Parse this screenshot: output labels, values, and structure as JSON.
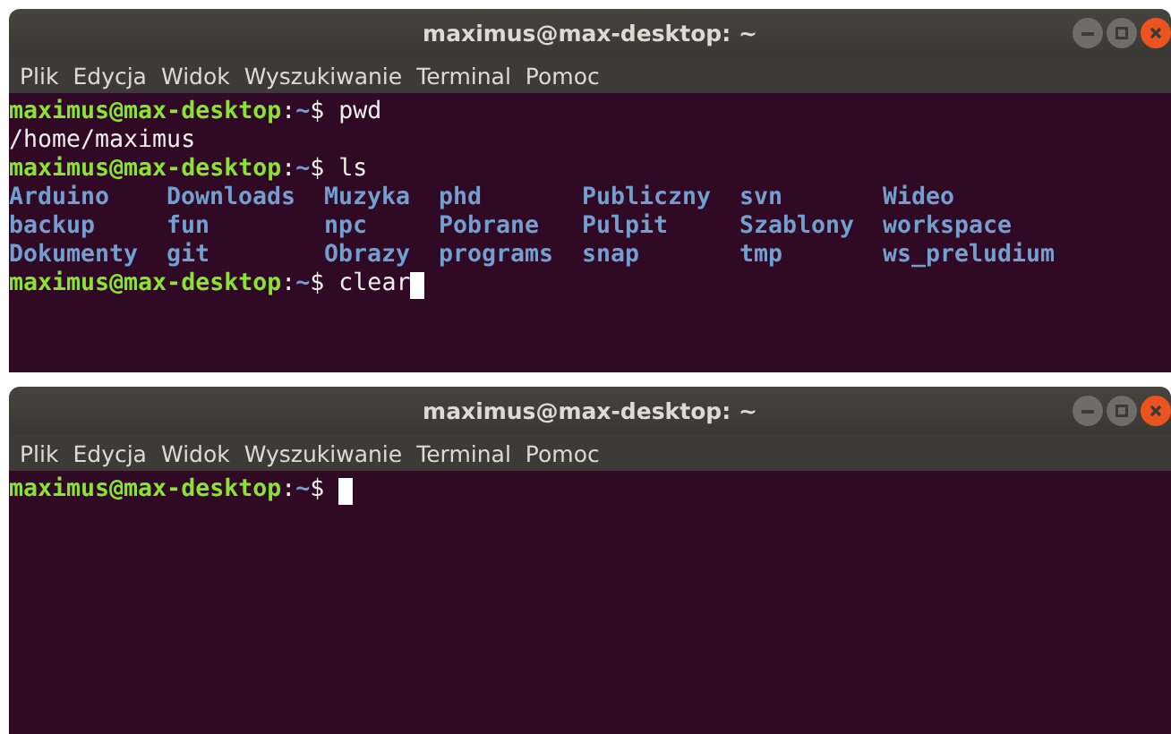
{
  "windows": [
    {
      "title": "maximus@max-desktop: ~",
      "menu": [
        "Plik",
        "Edycja",
        "Widok",
        "Wyszukiwanie",
        "Terminal",
        "Pomoc"
      ],
      "lines": [
        {
          "kind": "prompt",
          "user_host": "maximus@max-desktop",
          "separator": ":",
          "path": "~",
          "symbol": "$",
          "command": "pwd",
          "cursor": false
        },
        {
          "kind": "output",
          "text": "/home/maximus"
        },
        {
          "kind": "prompt",
          "user_host": "maximus@max-desktop",
          "separator": ":",
          "path": "~",
          "symbol": "$",
          "command": "ls",
          "cursor": false
        },
        {
          "kind": "listing",
          "rows": [
            [
              "Arduino",
              "Downloads",
              "Muzyka",
              "phd",
              "Publiczny",
              "svn",
              "Wideo"
            ],
            [
              "backup",
              "fun",
              "npc",
              "Pobrane",
              "Pulpit",
              "Szablony",
              "workspace"
            ],
            [
              "Dokumenty",
              "git",
              "Obrazy",
              "programs",
              "snap",
              "tmp",
              "ws_preludium"
            ]
          ]
        },
        {
          "kind": "prompt",
          "user_host": "maximus@max-desktop",
          "separator": ":",
          "path": "~",
          "symbol": "$",
          "command": "clear",
          "cursor": true
        }
      ]
    },
    {
      "title": "maximus@max-desktop: ~",
      "menu": [
        "Plik",
        "Edycja",
        "Widok",
        "Wyszukiwanie",
        "Terminal",
        "Pomoc"
      ],
      "lines": [
        {
          "kind": "prompt",
          "user_host": "maximus@max-desktop",
          "separator": ":",
          "path": "~",
          "symbol": "$",
          "cursor": true
        }
      ]
    }
  ]
}
